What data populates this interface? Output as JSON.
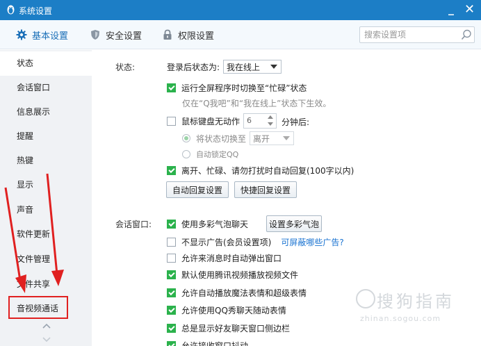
{
  "window": {
    "title": "系统设置",
    "minimize": "_",
    "close": "✕",
    "accent": "#1c7ec6"
  },
  "tabs": [
    {
      "label": "基本设置",
      "icon": "gear-icon"
    },
    {
      "label": "安全设置",
      "icon": "shield-icon"
    },
    {
      "label": "权限设置",
      "icon": "lock-icon"
    }
  ],
  "search": {
    "placeholder": "搜索设置项"
  },
  "sidebar": {
    "items": [
      {
        "label": "状态"
      },
      {
        "label": "会话窗口"
      },
      {
        "label": "信息展示"
      },
      {
        "label": "提醒"
      },
      {
        "label": "热键"
      },
      {
        "label": "显示"
      },
      {
        "label": "声音"
      },
      {
        "label": "软件更新"
      },
      {
        "label": "文件管理"
      },
      {
        "label": "文件共享"
      },
      {
        "label": "音视频通话"
      }
    ]
  },
  "status_section": {
    "label": "状态:",
    "login_status_label": "登录后状态为:",
    "login_status_value": "我在线上",
    "fullscreen_busy": "运行全屏程序时切换至“忙碌”状态",
    "fullscreen_note": "仅在“Q我吧”和“我在线上”状态下生效。",
    "idle_label": "鼠标键盘无动作",
    "idle_minutes": "6",
    "idle_suffix": "分钟后:",
    "switch_status_label": "将状态切换至",
    "switch_status_value": "离开",
    "auto_lock": "自动锁定QQ",
    "auto_reply": "离开、忙碌、请勿打扰时自动回复(100字以内)",
    "auto_reply_btn": "自动回复设置",
    "quick_reply_btn": "快捷回复设置"
  },
  "chat_section": {
    "label": "会话窗口:",
    "multicolor_bubble": "使用多彩气泡聊天",
    "multicolor_btn": "设置多彩气泡",
    "no_ads": "不显示广告(会员设置项)",
    "ads_link": "可屏蔽哪些广告?",
    "auto_popup": "允许来消息时自动弹出窗口",
    "tencent_video": "默认使用腾讯视频播放视频文件",
    "magic_emoji": "允许自动播放魔法表情和超级表情",
    "qq_show": "允许使用QQ秀聊天随动表情",
    "sidebar_show": "总是显示好友聊天窗口侧边栏",
    "shake": "允许接收窗口抖动"
  },
  "watermark": {
    "big": "搜狗指南",
    "small": "zhinan.sogou.com"
  }
}
